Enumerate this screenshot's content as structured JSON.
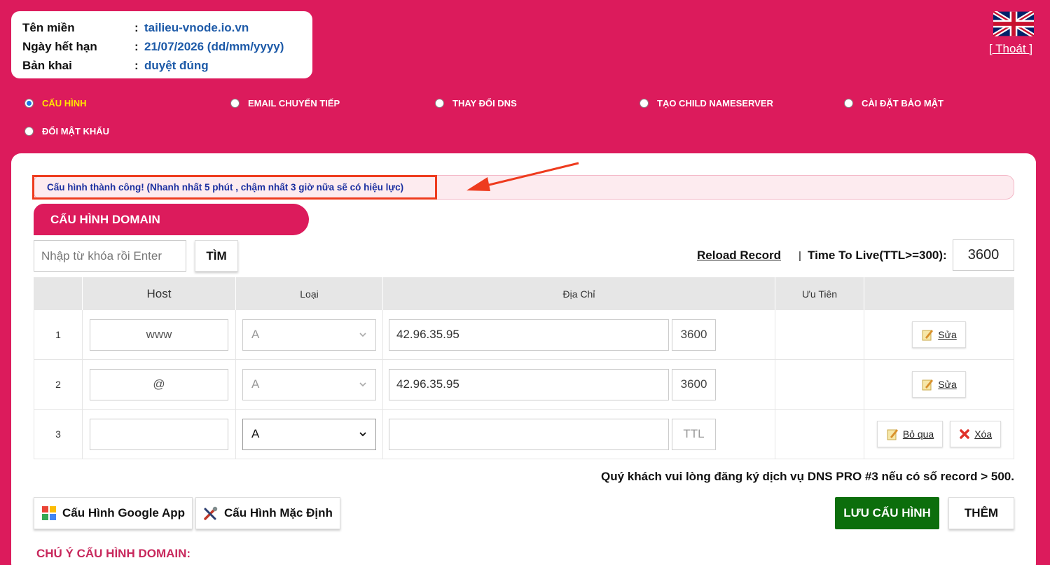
{
  "info": {
    "rows": [
      {
        "key": "Tên miền",
        "value": "tailieu-vnode.io.vn"
      },
      {
        "key": "Ngày hết hạn",
        "value": "21/07/2026 (dd/mm/yyyy)"
      },
      {
        "key": "Bản khai",
        "value": "duyệt đúng"
      }
    ],
    "colon": ":"
  },
  "header": {
    "logout_label": "[ Thoát ]",
    "flag_icon": "uk-flag-icon"
  },
  "menu": {
    "items": [
      {
        "label": "CẤU HÌNH",
        "checked": true
      },
      {
        "label": "EMAIL CHUYỂN TIẾP",
        "checked": false
      },
      {
        "label": "THAY ĐỔI DNS",
        "checked": false
      },
      {
        "label": "TẠO CHILD NAMESERVER",
        "checked": false
      },
      {
        "label": "CÀI ĐẶT BẢO MẬT",
        "checked": false
      },
      {
        "label": "ĐỔI MẬT KHẨU",
        "checked": false
      }
    ]
  },
  "notice": {
    "text": "Cấu hình thành công! (Nhanh nhất 5 phút , chậm nhất 3 giờ nữa sẽ có hiệu lực)",
    "highlight_color": "#ee3b1e"
  },
  "section": {
    "title": "CẤU HÌNH DOMAIN"
  },
  "search": {
    "placeholder": "Nhập từ khóa rồi Enter",
    "button_label": "TÌM"
  },
  "toolbar": {
    "reload_label": "Reload Record",
    "separator": "|",
    "ttl_label": "Time To Live(TTL>=300):",
    "ttl_value": "3600"
  },
  "table": {
    "headers": {
      "no": "",
      "host": "Host",
      "type": "Loại",
      "address": "Địa Chỉ",
      "priority": "Ưu Tiên",
      "actions": ""
    },
    "rows": [
      {
        "no": "1",
        "host": "www",
        "type": "A",
        "address": "42.96.35.95",
        "ttl": "3600",
        "edit_label": "Sửa"
      },
      {
        "no": "2",
        "host": "@",
        "type": "A",
        "address": "42.96.35.95",
        "ttl": "3600",
        "edit_label": "Sửa"
      },
      {
        "no": "3",
        "host": "",
        "type": "A",
        "address": "",
        "ttl_placeholder": "TTL",
        "skip_label": "Bỏ qua",
        "delete_label": "Xóa"
      }
    ]
  },
  "dns_note": "Quý khách vui lòng đăng ký dịch vụ DNS PRO #3 nếu có số record > 500.",
  "buttons": {
    "google_app": "Cấu Hình Google App",
    "default_config": "Cấu Hình Mặc Định",
    "save": "LƯU CẤU HÌNH",
    "add": "THÊM"
  },
  "footer_note_title": "CHÚ Ý CẤU HÌNH DOMAIN:",
  "colors": {
    "brand": "#dc1b5c",
    "save_green": "#0c6e0c",
    "link_blue": "#1d5aa8"
  }
}
